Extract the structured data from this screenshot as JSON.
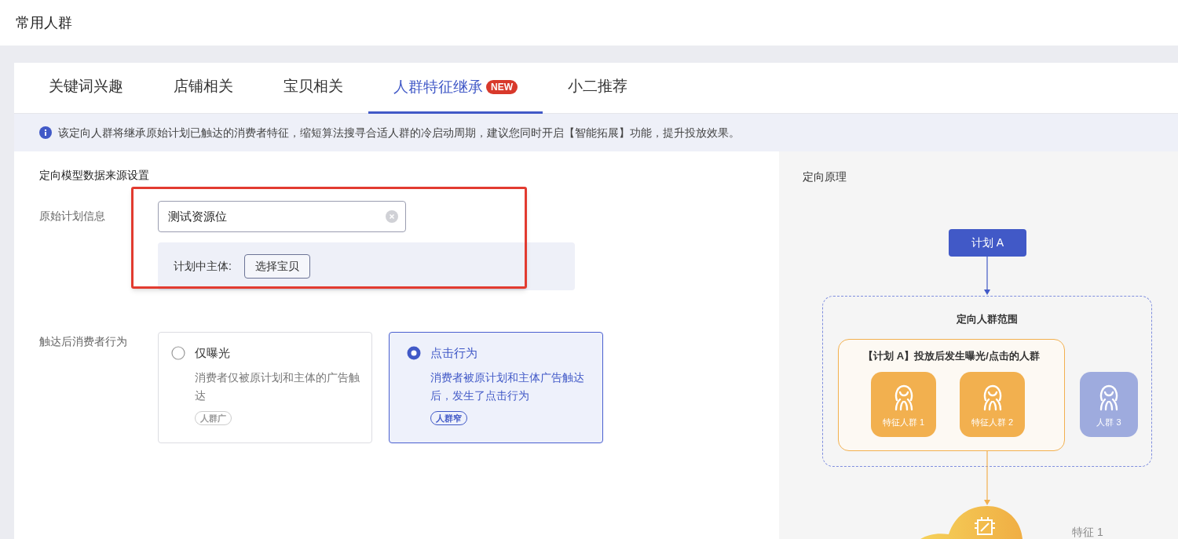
{
  "header": {
    "title": "常用人群"
  },
  "tabs": [
    {
      "label": "关键词兴趣",
      "selected": false
    },
    {
      "label": "店铺相关",
      "selected": false
    },
    {
      "label": "宝贝相关",
      "selected": false
    },
    {
      "label": "人群特征继承",
      "selected": true,
      "badge": "NEW"
    },
    {
      "label": "小二推荐",
      "selected": false
    }
  ],
  "notice": "该定向人群将继承原始计划已触达的消费者特征，缩短算法搜寻合适人群的冷启动周期，建议您同时开启【智能拓展】功能，提升投放效果。",
  "form": {
    "section_title": "定向模型数据来源设置",
    "plan_label": "原始计划信息",
    "plan_field": {
      "value": "测试资源位"
    },
    "subject_label": "计划中主体:",
    "subject_button": "选择宝贝",
    "behavior_label": "触达后消费者行为",
    "options": [
      {
        "title": "仅曝光",
        "description": "消费者仅被原计划和主体的广告触达",
        "tag": "人群广",
        "selected": false
      },
      {
        "title": "点击行为",
        "description": "消费者被原计划和主体广告触达后，发生了点击行为",
        "tag": "人群窄",
        "selected": true
      }
    ]
  },
  "diagram": {
    "title": "定向原理",
    "plan_node": "计划 A",
    "scope_label": "定向人群范围",
    "group_label": "【计划 A】投放后发生曝光/点击的人群",
    "crowds": [
      {
        "label": "特征人群 1",
        "color": "#f2b04f"
      },
      {
        "label": "特征人群 2",
        "color": "#f2b04f"
      },
      {
        "label": "人群 3",
        "color": "#9eabde"
      }
    ],
    "feature_label": "特征 1"
  }
}
